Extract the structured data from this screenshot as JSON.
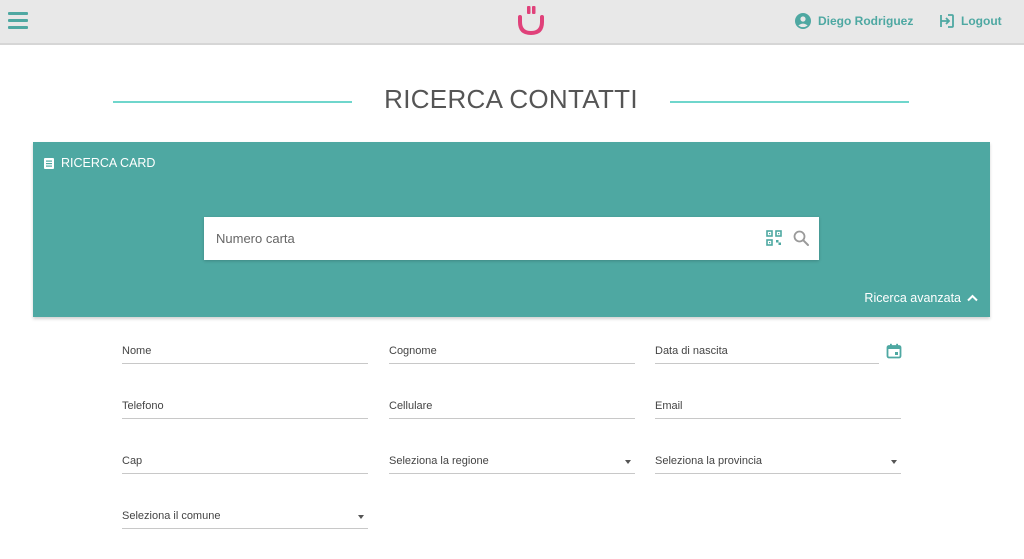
{
  "header": {
    "menu_icon": "hamburger-menu-icon",
    "logo_icon": "smile-logo-icon",
    "user_name": "Diego Rodriguez",
    "logout_label": "Logout",
    "accent_color": "#4ea8a2",
    "logo_color": "#e0417a"
  },
  "page": {
    "title": "RICERCA CONTATTI"
  },
  "card_search": {
    "header_label": "RICERCA CARD",
    "search_placeholder": "Numero carta",
    "advanced_label": "Ricerca avanzata",
    "panel_color": "#4ea8a2"
  },
  "form": {
    "nome": "Nome",
    "cognome": "Cognome",
    "data_nascita": "Data di nascita",
    "telefono": "Telefono",
    "cellulare": "Cellulare",
    "email": "Email",
    "cap": "Cap",
    "regione": "Seleziona la regione",
    "provincia": "Seleziona la provincia",
    "comune": "Seleziona il comune"
  }
}
